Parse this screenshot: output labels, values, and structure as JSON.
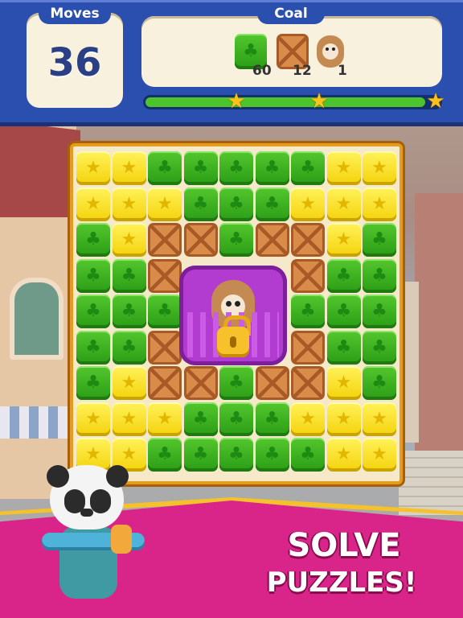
{
  "hud": {
    "moves_label": "Moves",
    "moves_value": "36",
    "goal_label": "Coal",
    "goals": [
      {
        "icon": "green-clover-block-icon",
        "count": "60"
      },
      {
        "icon": "wooden-crate-icon",
        "count": "12"
      },
      {
        "icon": "puppy-icon",
        "count": "1"
      }
    ],
    "progress_fraction": 0.95,
    "stars": [
      "star-icon",
      "star-icon",
      "star-icon"
    ]
  },
  "board": {
    "rows": [
      [
        "Y",
        "Y",
        "G",
        "G",
        "G",
        "G",
        "G",
        "Y",
        "Y"
      ],
      [
        "Y",
        "Y",
        "Y",
        "G",
        "G",
        "G",
        "Y",
        "Y",
        "Y"
      ],
      [
        "G",
        "Y",
        "C",
        "C",
        "G",
        "C",
        "C",
        "Y",
        "G"
      ],
      [
        "G",
        "G",
        "C",
        "X",
        "X",
        "X",
        "C",
        "G",
        "G"
      ],
      [
        "G",
        "G",
        "G",
        "X",
        "X",
        "X",
        "G",
        "G",
        "G"
      ],
      [
        "G",
        "G",
        "C",
        "X",
        "X",
        "X",
        "C",
        "G",
        "G"
      ],
      [
        "G",
        "Y",
        "C",
        "C",
        "G",
        "C",
        "C",
        "Y",
        "G"
      ],
      [
        "Y",
        "Y",
        "Y",
        "G",
        "G",
        "G",
        "Y",
        "Y",
        "Y"
      ],
      [
        "Y",
        "Y",
        "G",
        "G",
        "G",
        "G",
        "G",
        "Y",
        "Y"
      ]
    ],
    "legend": {
      "G": "green-clover-block",
      "Y": "yellow-star-block",
      "C": "wooden-crate",
      "X": "caged-pet"
    },
    "colors": {
      "green": "#2a9d16",
      "yellow": "#f4d20a",
      "crate": "#d98b4a",
      "frame": "#e59b1d"
    }
  },
  "banner": {
    "line1": "SOLVE",
    "line2": "PUZZLES!",
    "color": "#d9258a"
  }
}
